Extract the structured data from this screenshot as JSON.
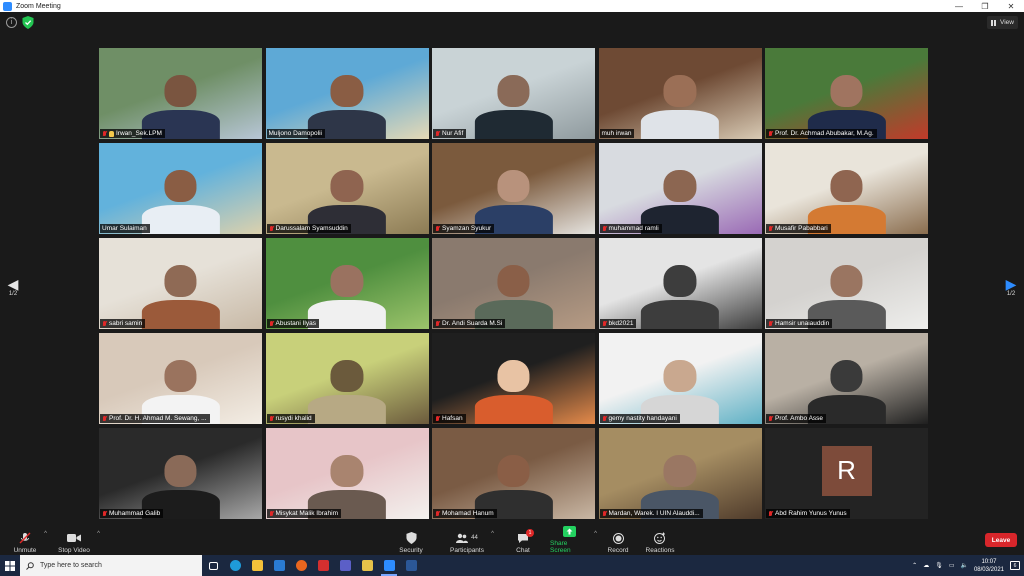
{
  "window": {
    "title": "Zoom Meeting"
  },
  "topbar": {
    "view_label": "View"
  },
  "pagination": {
    "left_label": "1/2",
    "right_label": "1/2"
  },
  "participants": [
    {
      "name": "Irwan_Sek.LPM",
      "muted": true,
      "hand": true,
      "bg": "#6f8f66",
      "bg2": "#b7c6d6",
      "skin": "#7a5540",
      "shirt": "#2a3553"
    },
    {
      "name": "Muljono Damopolii",
      "muted": false,
      "hand": false,
      "bg": "#5ea9d6",
      "bg2": "#e5d9b6",
      "skin": "#8a5d44",
      "shirt": "#2e3648"
    },
    {
      "name": "Nur Afif",
      "muted": true,
      "hand": false,
      "bg": "#c9d3d6",
      "bg2": "#8f9a9e",
      "skin": "#8a6a58",
      "shirt": "#1f2a33"
    },
    {
      "name": "muh irwan",
      "muted": false,
      "hand": false,
      "bg": "#6e4a34",
      "bg2": "#d8cab4",
      "skin": "#9b6f56",
      "shirt": "#dfe3e8"
    },
    {
      "name": "Prof. Dr. Achmad Abubakar, M.Ag.",
      "muted": true,
      "hand": false,
      "bg": "#4a7a3a",
      "bg2": "#c23a2a",
      "skin": "#a07460",
      "shirt": "#1f2b4a"
    },
    {
      "name": "Umar Sulaiman",
      "muted": false,
      "hand": false,
      "bg": "#62b2dc",
      "bg2": "#dcd1ad",
      "skin": "#8a5d44",
      "shirt": "#e8eef4",
      "active": true
    },
    {
      "name": "Darussalam Syamsuddin",
      "muted": true,
      "hand": false,
      "bg": "#c9b98f",
      "bg2": "#8c7b54",
      "skin": "#8f6450",
      "shirt": "#2e2e36"
    },
    {
      "name": "Syamzan Syukur",
      "muted": true,
      "hand": false,
      "bg": "#7b5a3d",
      "bg2": "#e6e4e0",
      "skin": "#b8927c",
      "shirt": "#2b3f66"
    },
    {
      "name": "muhammad ramli",
      "muted": true,
      "hand": false,
      "bg": "#d8dbe0",
      "bg2": "#9a6ab5",
      "skin": "#8c6651",
      "shirt": "#1e2430"
    },
    {
      "name": "Musafir Pababbari",
      "muted": true,
      "hand": false,
      "bg": "#e9e4da",
      "bg2": "#8a6d4e",
      "skin": "#8f6550",
      "shirt": "#d47a33"
    },
    {
      "name": "sabri samin",
      "muted": true,
      "hand": false,
      "bg": "#e6e1d8",
      "bg2": "#c8b9a6",
      "skin": "#8f6a55",
      "shirt": "#9b5a3a"
    },
    {
      "name": "Abustani Ilyas",
      "muted": true,
      "hand": false,
      "bg": "#4f8f3f",
      "bg2": "#9cc46b",
      "skin": "#9a7260",
      "shirt": "#f0f0f0"
    },
    {
      "name": "Dr. Andi Suarda M.Si",
      "muted": true,
      "hand": false,
      "bg": "#8a7a6e",
      "bg2": "#b69b84",
      "skin": "#8a5f48",
      "shirt": "#5a6a5a"
    },
    {
      "name": "bkd2021",
      "muted": true,
      "hand": false,
      "bg": "#e4e4e4",
      "bg2": "#3d3d3d",
      "skin": "#3d3d3d",
      "shirt": "#3d3d3d"
    },
    {
      "name": "Hamsir unaiauddin",
      "muted": true,
      "hand": false,
      "bg": "#d4d2cf",
      "bg2": "#eeeeec",
      "skin": "#9a7561",
      "shirt": "#5a5a5a"
    },
    {
      "name": "Prof. Dr. H. Ahmad M. Sewang, ...",
      "muted": true,
      "hand": false,
      "bg": "#d8c9ba",
      "bg2": "#f3ede4",
      "skin": "#9a735e",
      "shirt": "#f3f3f3"
    },
    {
      "name": "rusydi khalid",
      "muted": true,
      "hand": false,
      "bg": "#c8d07a",
      "bg2": "#6b5a3c",
      "skin": "#6b5a3c",
      "shirt": "#b7a984"
    },
    {
      "name": "Hafsan",
      "muted": true,
      "hand": false,
      "bg": "#1f1f1f",
      "bg2": "#e58a4a",
      "skin": "#e8c3a4",
      "shirt": "#d95d2d"
    },
    {
      "name": "gemy nastity handayani",
      "muted": true,
      "hand": false,
      "bg": "#f2f2f2",
      "bg2": "#5fb1c5",
      "skin": "#c9a88f",
      "shirt": "#d6d6d6"
    },
    {
      "name": "Prof. Ambo Asse",
      "muted": true,
      "hand": false,
      "bg": "#b9b0a4",
      "bg2": "#1f1f1f",
      "skin": "#3a3a3a",
      "shirt": "#2a2a2a"
    },
    {
      "name": "Muhammad Galib",
      "muted": true,
      "hand": false,
      "bg": "#2a2a2a",
      "bg2": "#a7a7a7",
      "skin": "#8a6a58",
      "shirt": "#1c1c1c"
    },
    {
      "name": "Misykat Malik Ibrahim",
      "muted": true,
      "hand": false,
      "bg": "#e7c5c8",
      "bg2": "#f3f1ee",
      "skin": "#a9846f",
      "shirt": "#6a5a50"
    },
    {
      "name": "Mohamad Hanum",
      "muted": true,
      "hand": false,
      "bg": "#7a5b44",
      "bg2": "#c9b7a4",
      "skin": "#8a5e46",
      "shirt": "#2f2f2f"
    },
    {
      "name": "Mardan, Warek. I UIN Alauddi...",
      "muted": true,
      "hand": false,
      "bg": "#a58d62",
      "bg2": "#4f3b2b",
      "skin": "#9a7763",
      "shirt": "#4a5666"
    },
    {
      "name": "Abd Rahim Yunus Yunus",
      "muted": true,
      "hand": false,
      "avatar": "R"
    }
  ],
  "toolbar": {
    "unmute": "Unmute",
    "stop_video": "Stop Video",
    "security": "Security",
    "participants": "Participants",
    "participants_count": "44",
    "chat": "Chat",
    "chat_badge": "1",
    "share_screen": "Share Screen",
    "record": "Record",
    "reactions": "Reactions",
    "leave": "Leave"
  },
  "taskbar": {
    "search_placeholder": "Type here to search",
    "time": "10:07",
    "date": "08/03/2021",
    "notifications": "6"
  },
  "colors": {
    "accent_blue": "#2d8cff",
    "share_green": "#23d160",
    "leave_red": "#d8262b",
    "active_speaker": "#c8e23b"
  }
}
